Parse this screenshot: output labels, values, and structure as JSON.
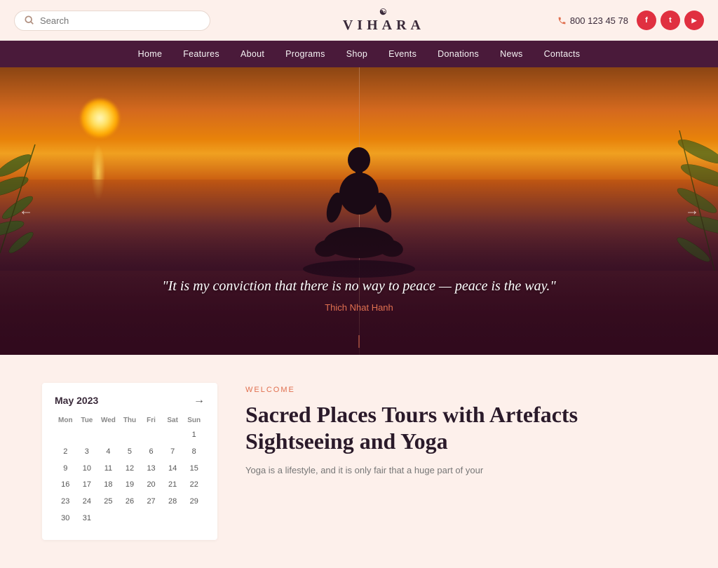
{
  "header": {
    "search_placeholder": "Search",
    "logo_text": "VIHARA",
    "logo_symbol": "☯",
    "phone": "800 123 45 78",
    "social": [
      {
        "name": "facebook",
        "label": "f"
      },
      {
        "name": "twitter",
        "label": "t"
      },
      {
        "name": "youtube",
        "label": "▶"
      }
    ]
  },
  "nav": {
    "items": [
      {
        "label": "Home",
        "id": "nav-home"
      },
      {
        "label": "Features",
        "id": "nav-features"
      },
      {
        "label": "About",
        "id": "nav-about"
      },
      {
        "label": "Programs",
        "id": "nav-programs"
      },
      {
        "label": "Shop",
        "id": "nav-shop"
      },
      {
        "label": "Events",
        "id": "nav-events"
      },
      {
        "label": "Donations",
        "id": "nav-donations"
      },
      {
        "label": "News",
        "id": "nav-news"
      },
      {
        "label": "Contacts",
        "id": "nav-contacts"
      }
    ]
  },
  "hero": {
    "quote": "\"It is my conviction that there is no way to peace — peace is the way.\"",
    "author": "Thich Nhat Hanh",
    "arrow_left": "←",
    "arrow_right": "→"
  },
  "calendar": {
    "month_year": "May 2023",
    "next_arrow": "→",
    "day_headers": [
      "Mon",
      "Tue",
      "Wed",
      "Thu",
      "Fri",
      "Sat",
      "Sun"
    ],
    "weeks": [
      [
        "",
        "",
        "",
        "",
        "",
        "",
        "1"
      ],
      [
        "2",
        "3",
        "4",
        "5",
        "6",
        "7",
        "8"
      ],
      [
        "9",
        "10",
        "11",
        "12",
        "13",
        "14",
        "15"
      ],
      [
        "16",
        "17",
        "18",
        "19",
        "20",
        "21",
        "22"
      ],
      [
        "23",
        "24",
        "25",
        "26",
        "27",
        "28",
        "29"
      ],
      [
        "30",
        "31",
        "",
        "",
        "",
        "",
        ""
      ]
    ]
  },
  "welcome": {
    "label": "Welcome",
    "title": "Sacred Places Tours with Artefacts Sightseeing and Yoga",
    "body": "Yoga is a lifestyle, and it is only fair that a huge part of your"
  }
}
